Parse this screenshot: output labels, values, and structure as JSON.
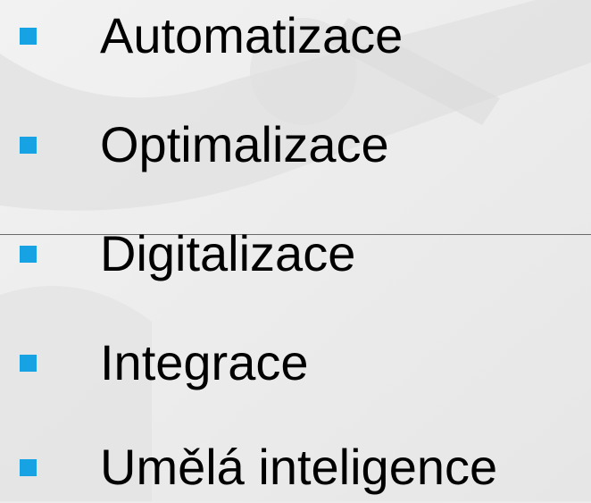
{
  "slide": {
    "bullet_color": "#17a3e3",
    "background_color": "#ececec",
    "items": [
      {
        "label": "Automatizace"
      },
      {
        "label": "Optimalizace"
      },
      {
        "label": "Digitalizace"
      },
      {
        "label": "Integrace"
      },
      {
        "label": "Umělá inteligence"
      }
    ]
  }
}
